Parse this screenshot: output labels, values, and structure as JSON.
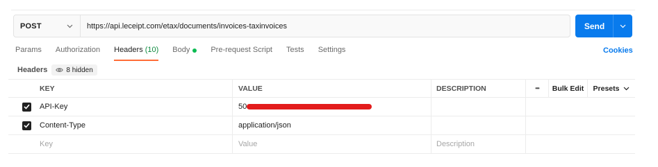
{
  "request": {
    "method": "POST",
    "url": "https://api.leceipt.com/etax/documents/invoices-taxinvoices",
    "send_label": "Send"
  },
  "tabs": [
    {
      "label": "Params"
    },
    {
      "label": "Authorization"
    },
    {
      "label": "Headers",
      "count": "(10)",
      "active": true
    },
    {
      "label": "Body",
      "indicator": "green-dot"
    },
    {
      "label": "Pre-request Script"
    },
    {
      "label": "Tests"
    },
    {
      "label": "Settings"
    }
  ],
  "cookies_label": "Cookies",
  "headers_section": {
    "title": "Headers",
    "hidden_label": "8 hidden",
    "hidden_icon": "eye-icon"
  },
  "table": {
    "columns": {
      "key": "KEY",
      "value": "VALUE",
      "description": "DESCRIPTION",
      "more": "•••",
      "bulk_edit": "Bulk Edit",
      "presets": "Presets"
    },
    "rows": [
      {
        "checked": true,
        "key": "API-Key",
        "value": "50",
        "value_redacted": true,
        "description": ""
      },
      {
        "checked": true,
        "key": "Content-Type",
        "value": "application/json",
        "description": ""
      }
    ],
    "empty_row": {
      "key_placeholder": "Key",
      "value_placeholder": "Value",
      "description_placeholder": "Description"
    }
  },
  "colors": {
    "accent_blue": "#097bed",
    "active_tab_underline": "#ff6c37",
    "count_green": "#0c8a3e",
    "body_dot": "#0cbb52",
    "redaction": "#e31c1c"
  }
}
